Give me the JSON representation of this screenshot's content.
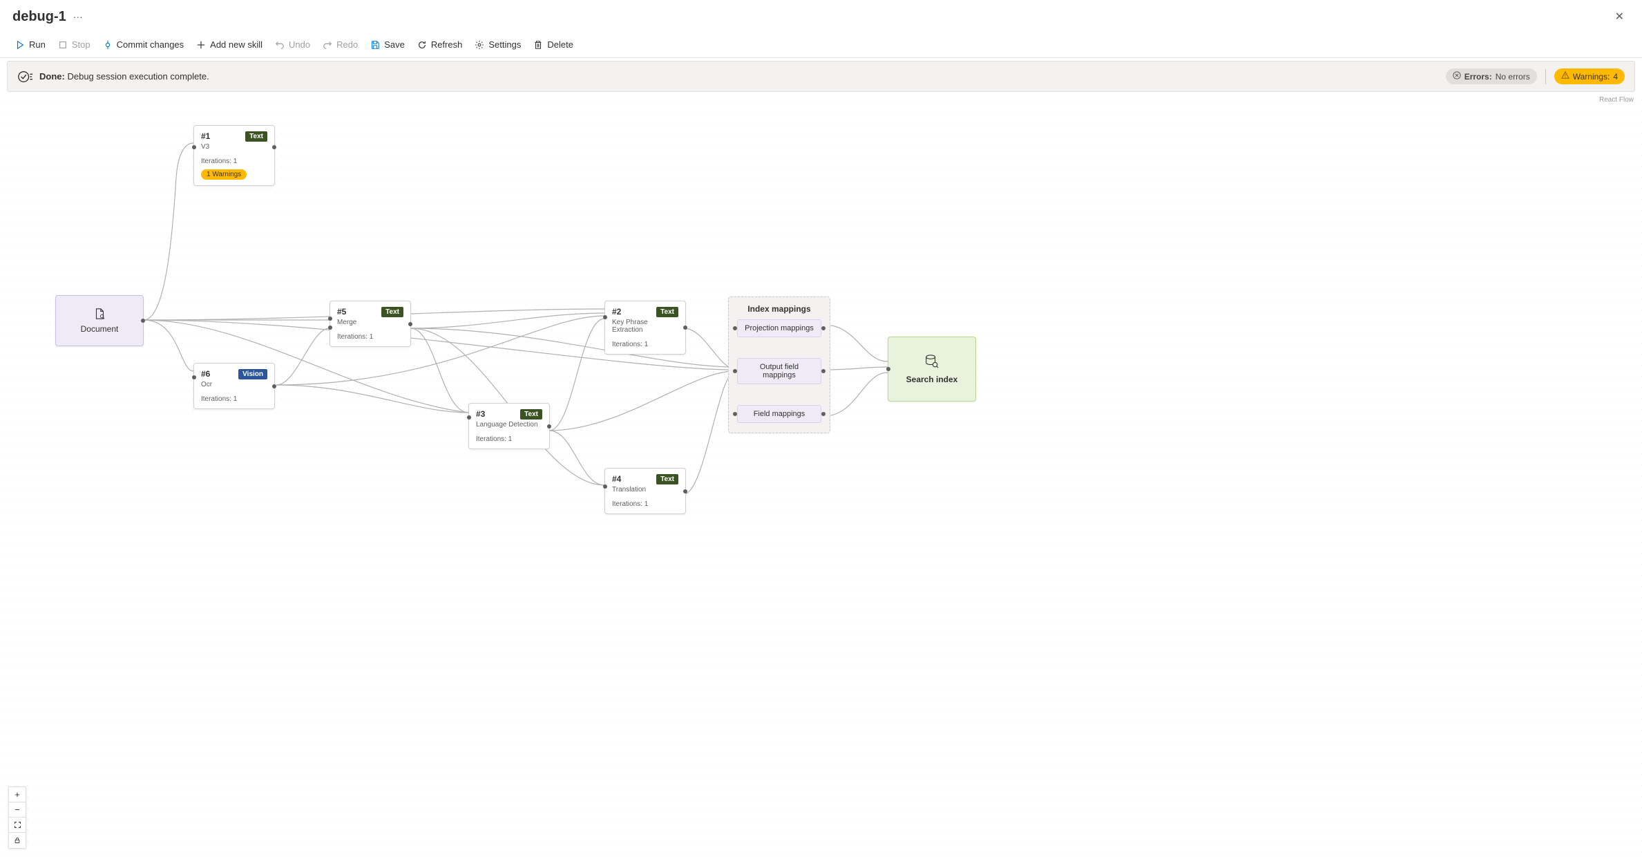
{
  "header": {
    "title": "debug-1"
  },
  "toolbar": {
    "run": "Run",
    "stop": "Stop",
    "commit": "Commit changes",
    "add_skill": "Add new skill",
    "undo": "Undo",
    "redo": "Redo",
    "save": "Save",
    "refresh": "Refresh",
    "settings": "Settings",
    "delete": "Delete"
  },
  "status": {
    "done_label": "Done:",
    "done_msg": "Debug session execution complete.",
    "errors_label": "Errors:",
    "errors_value": "No errors",
    "warnings_label": "Warnings:",
    "warnings_value": "4"
  },
  "canvas": {
    "attribution": "React Flow",
    "doc_node": {
      "label": "Document"
    },
    "nodes": {
      "n1": {
        "id": "#1",
        "sub": "V3",
        "badge": "Text",
        "iterations": "Iterations: 1",
        "warn": "1 Warnings"
      },
      "n5": {
        "id": "#5",
        "sub": "Merge",
        "badge": "Text",
        "iterations": "Iterations: 1"
      },
      "n6": {
        "id": "#6",
        "sub": "Ocr",
        "badge": "Vision",
        "iterations": "Iterations: 1"
      },
      "n3": {
        "id": "#3",
        "sub": "Language Detection",
        "badge": "Text",
        "iterations": "Iterations: 1"
      },
      "n2": {
        "id": "#2",
        "sub": "Key Phrase Extraction",
        "badge": "Text",
        "iterations": "Iterations: 1"
      },
      "n4": {
        "id": "#4",
        "sub": "Translation",
        "badge": "Text",
        "iterations": "Iterations: 1"
      }
    },
    "mappings": {
      "title": "Index mappings",
      "projection": "Projection mappings",
      "output": "Output field mappings",
      "field": "Field mappings"
    },
    "search_node": {
      "label": "Search index"
    }
  }
}
